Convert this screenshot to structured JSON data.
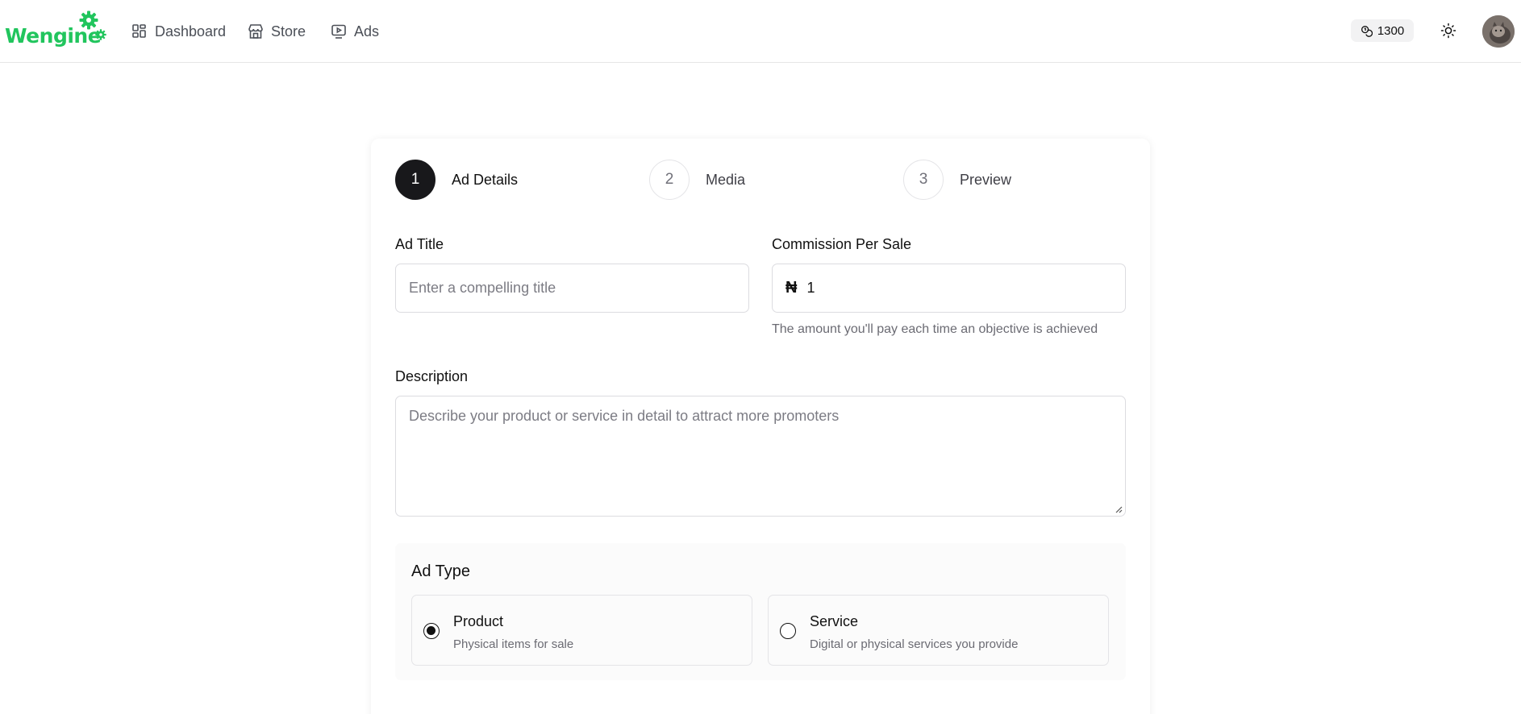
{
  "nav": {
    "logo_text": "Wengine",
    "links": [
      {
        "label": "Dashboard",
        "icon": "grid-icon"
      },
      {
        "label": "Store",
        "icon": "store-icon"
      },
      {
        "label": "Ads",
        "icon": "ads-icon"
      }
    ],
    "credits": "1300",
    "brand_color": "#21c55d"
  },
  "stepper": {
    "steps": [
      {
        "number": "1",
        "label": "Ad Details",
        "active": true
      },
      {
        "number": "2",
        "label": "Media",
        "active": false
      },
      {
        "number": "3",
        "label": "Preview",
        "active": false
      }
    ]
  },
  "form": {
    "ad_title": {
      "label": "Ad Title",
      "placeholder": "Enter a compelling title",
      "value": ""
    },
    "commission": {
      "label": "Commission Per Sale",
      "currency": "₦",
      "value": "1",
      "hint": "The amount you'll pay each time an objective is achieved"
    },
    "description": {
      "label": "Description",
      "placeholder": "Describe your product or service in detail to attract more promoters",
      "value": ""
    },
    "ad_type": {
      "title": "Ad Type",
      "selected": "Product",
      "options": [
        {
          "title": "Product",
          "description": "Physical items for sale"
        },
        {
          "title": "Service",
          "description": "Digital or physical services you provide"
        }
      ]
    }
  }
}
